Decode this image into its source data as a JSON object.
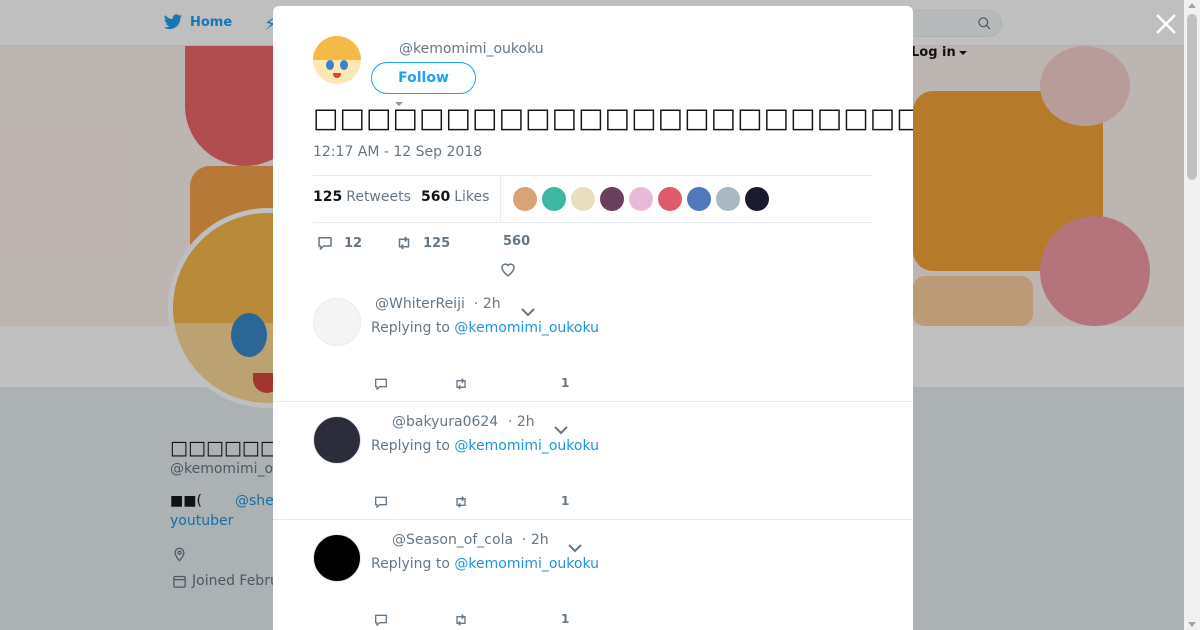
{
  "nav": {
    "home_label": "Home",
    "login_label": "Log in"
  },
  "profile": {
    "display_name": "□□□□□□□□□□",
    "handle": "@kemomimi_o",
    "bio_prefix": "■■(",
    "bio_link": "@she",
    "bio_line2": "youtuber",
    "joined": "Joined Febru"
  },
  "modal": {
    "author_handle": "@kemomimi_oukoku",
    "follow_label": "Follow",
    "tweet_text": "□□□□□□□□□□□□□□□□□□□□□□□□□□□□□□□□□□□□□□□□□□□□□□",
    "timestamp": "12:17 AM - 12 Sep 2018",
    "stats": {
      "retweets_count": "125",
      "retweets_label": "Retweets",
      "likes_count": "560",
      "likes_label": "Likes"
    },
    "likers": [
      {
        "color": "#d9a37a"
      },
      {
        "color": "#3fb5a4"
      },
      {
        "color": "#e9dfc0"
      },
      {
        "color": "#6a3f5e"
      },
      {
        "color": "#e8b9d8"
      },
      {
        "color": "#e05a6e"
      },
      {
        "color": "#4f79b8"
      },
      {
        "color": "#aab8c2"
      },
      {
        "color": "#1a1a2e"
      }
    ],
    "actions": {
      "reply_count": "12",
      "retweet_count": "125",
      "like_count": "560"
    },
    "replies": [
      {
        "handle": "@WhiterReiji",
        "time": "· 2h",
        "replying_prefix": "Replying to",
        "mention": "@kemomimi_oukoku",
        "like_count": "1",
        "avatar_color": "#f4f4f4"
      },
      {
        "handle": "@bakyura0624",
        "time": "· 2h",
        "replying_prefix": "Replying to",
        "mention": "@kemomimi_oukoku",
        "like_count": "1",
        "avatar_color": "#2b2b3a"
      },
      {
        "handle": "@Season_of_cola",
        "time": "· 2h",
        "replying_prefix": "Replying to",
        "mention": "@kemomimi_oukoku",
        "like_count": "1",
        "avatar_color": "#000000"
      }
    ]
  },
  "colors": {
    "twitter_blue": "#1da1f2",
    "link_blue": "#1b95e0",
    "secondary_text": "#657786"
  },
  "icons": [
    "twitter-bird-icon",
    "lightning-icon",
    "search-icon",
    "close-icon",
    "reply-icon",
    "retweet-icon",
    "heart-icon",
    "chevron-down-icon",
    "location-icon",
    "calendar-icon"
  ]
}
